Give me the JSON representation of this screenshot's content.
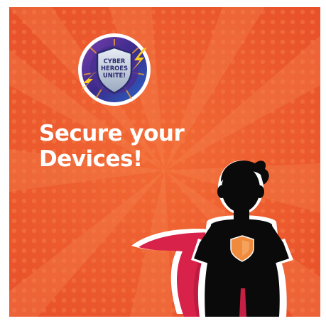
{
  "badge": {
    "line1": "CYBER",
    "line2": "HEROES",
    "line3": "UNITE!"
  },
  "headline": {
    "line1": "Secure your",
    "line2": "Devices!"
  },
  "colors": {
    "background": "#ee5a2a",
    "text": "#ffffff",
    "cape": "#d9224a",
    "silhouette": "#0a0a0a",
    "chest_emblem": "#f08a3c",
    "badge_ring": "#5a2a8a"
  },
  "icons": [
    "cyber-heroes-unite-badge-icon",
    "shield-icon",
    "lightning-bolt-icon",
    "superhero-silhouette-icon",
    "chest-shield-emblem-icon"
  ]
}
